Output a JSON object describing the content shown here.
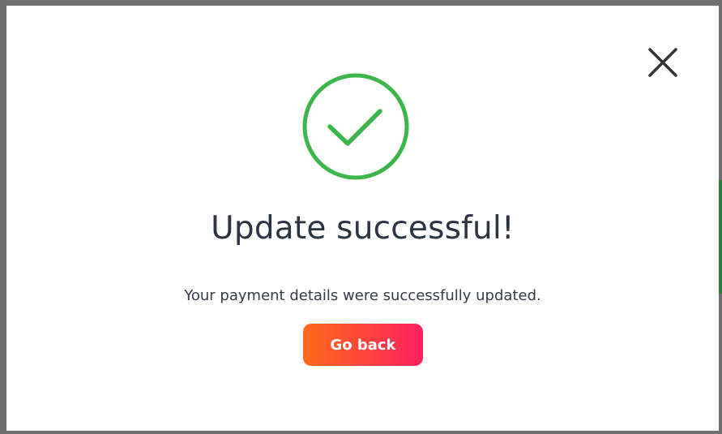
{
  "modal": {
    "title": "Update successful!",
    "message": "Your payment details were successfully updated.",
    "primary_button_label": "Go back",
    "close_icon": "close-icon",
    "status_icon": "check-circle-icon"
  },
  "colors": {
    "success": "#3cb54a",
    "title_text": "#2b3442",
    "button_gradient_start": "#ff6a1a",
    "button_gradient_end": "#ff1f5e"
  }
}
